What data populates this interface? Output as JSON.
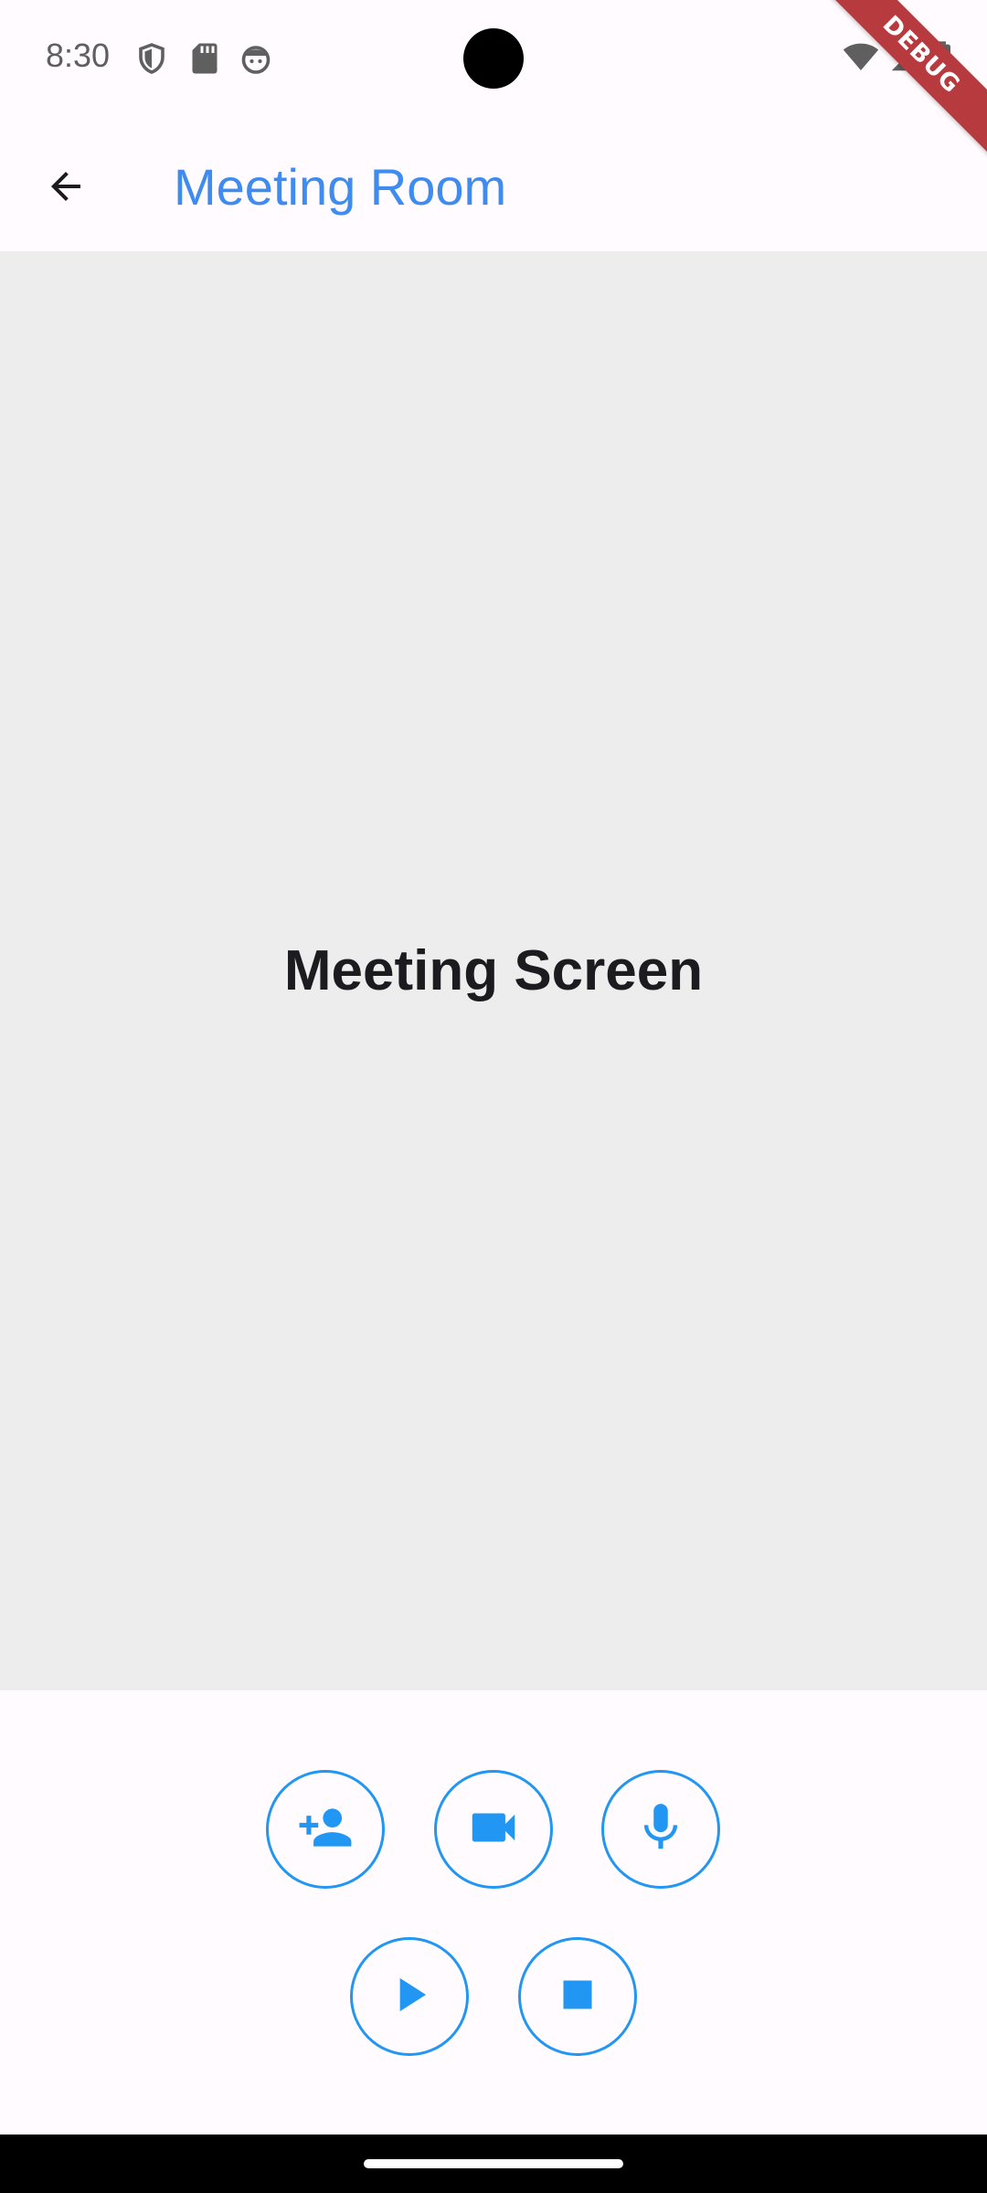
{
  "status_bar": {
    "time": "8:30",
    "left_icons": [
      "shield-icon",
      "sd-card-icon",
      "face-icon"
    ],
    "right_icons": [
      "wifi-icon",
      "signal-icon",
      "battery-icon"
    ]
  },
  "debug_banner": "DEBUG",
  "app_bar": {
    "back_icon": "arrow-back-icon",
    "title": "Meeting Room",
    "title_color": "#3f8cf0"
  },
  "meeting": {
    "label": "Meeting Screen",
    "background": "#ededed"
  },
  "controls": {
    "accent": "#2196f3",
    "row1": [
      {
        "name": "add-participant-button",
        "icon": "person-add-icon"
      },
      {
        "name": "video-button",
        "icon": "videocam-icon"
      },
      {
        "name": "mic-button",
        "icon": "mic-icon"
      }
    ],
    "row2": [
      {
        "name": "play-button",
        "icon": "play-icon"
      },
      {
        "name": "stop-button",
        "icon": "stop-icon"
      }
    ]
  }
}
